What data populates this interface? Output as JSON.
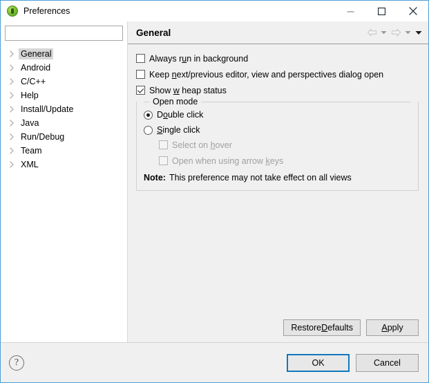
{
  "window": {
    "title": "Preferences",
    "icon": "eclipse-green-circle-icon",
    "border_color": "#4d9ed6",
    "controls": {
      "minimize": "minimize-icon",
      "maximize": "maximize-icon",
      "close": "close-icon"
    }
  },
  "sidebar": {
    "filter": {
      "value": "",
      "placeholder": ""
    },
    "items": [
      {
        "label": "General",
        "selected": true
      },
      {
        "label": "Android",
        "selected": false
      },
      {
        "label": "C/C++",
        "selected": false
      },
      {
        "label": "Help",
        "selected": false
      },
      {
        "label": "Install/Update",
        "selected": false
      },
      {
        "label": "Java",
        "selected": false
      },
      {
        "label": "Run/Debug",
        "selected": false
      },
      {
        "label": "Team",
        "selected": false
      },
      {
        "label": "XML",
        "selected": false
      }
    ]
  },
  "page": {
    "title": "General",
    "toolbar": {
      "back": "back-arrow-icon",
      "back_menu": "chevron-down-icon",
      "forward": "forward-arrow-icon",
      "forward_menu": "chevron-down-icon",
      "view_menu": "chevron-down-icon"
    },
    "checkboxes": [
      {
        "pre": "Always r",
        "mnemonic": "u",
        "post": "n in background",
        "checked": false,
        "enabled": true
      },
      {
        "pre": "Keep ",
        "mnemonic": "n",
        "post": "ext/previous editor, view and perspectives dialog open",
        "checked": false,
        "enabled": true
      },
      {
        "pre": "Show ",
        "mnemonic": "w",
        "post": " heap status",
        "checked": true,
        "enabled": true
      }
    ],
    "open_mode": {
      "title": "Open mode",
      "radios": [
        {
          "pre": "D",
          "mnemonic": "o",
          "post": "uble click",
          "checked": true
        },
        {
          "pre": "",
          "mnemonic": "S",
          "post": "ingle click",
          "checked": false
        }
      ],
      "sub_checkboxes": [
        {
          "pre": "Select on ",
          "mnemonic": "h",
          "post": "over",
          "checked": false,
          "enabled": false
        },
        {
          "pre": "Open when using arrow ",
          "mnemonic": "k",
          "post": "eys",
          "checked": false,
          "enabled": false
        }
      ],
      "note_label": "Note:",
      "note_text": "This preference may not take effect on all views"
    },
    "buttons": {
      "restore_pre": "Restore ",
      "restore_mnemonic": "D",
      "restore_post": "efaults",
      "apply_pre": "",
      "apply_mnemonic": "A",
      "apply_post": "pply"
    }
  },
  "footer": {
    "help": "?",
    "ok": "OK",
    "cancel": "Cancel",
    "default_button_color": "#1277bc"
  }
}
